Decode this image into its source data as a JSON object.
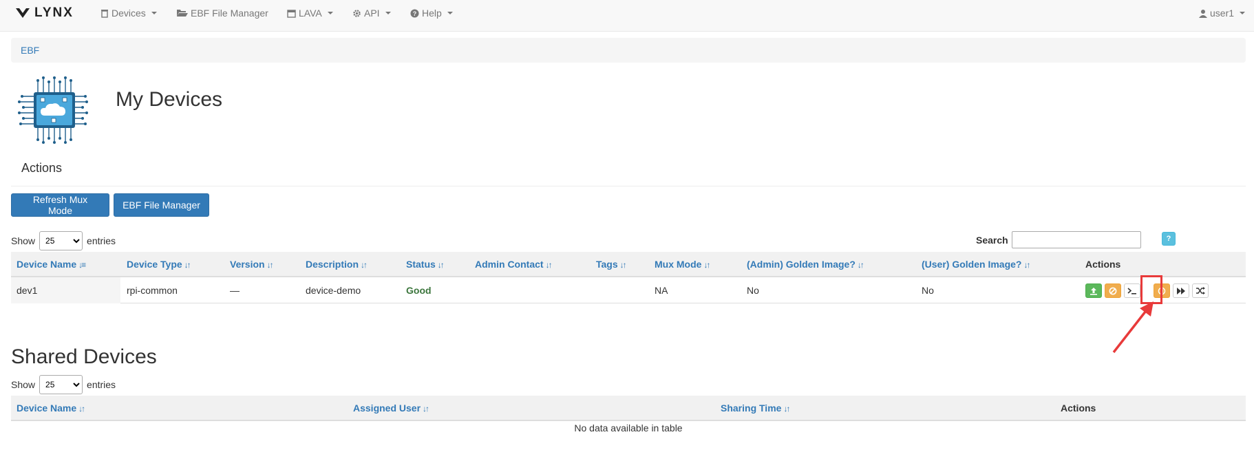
{
  "navbar": {
    "brand": "LYNX",
    "items": [
      {
        "label": "Devices",
        "icon": "trash-icon",
        "dropdown": true
      },
      {
        "label": "EBF File Manager",
        "icon": "folder-open-icon",
        "dropdown": false
      },
      {
        "label": "LAVA",
        "icon": "calendar-icon",
        "dropdown": true
      },
      {
        "label": "API",
        "icon": "gear-icon",
        "dropdown": true
      },
      {
        "label": "Help",
        "icon": "question-circle-icon",
        "dropdown": true
      }
    ],
    "user": "user1"
  },
  "breadcrumb": "EBF",
  "page_title": "My Devices",
  "actions_title": "Actions",
  "buttons": {
    "refresh_mux": "Refresh Mux Mode",
    "ebf_file_manager": "EBF File Manager"
  },
  "my_devices": {
    "show_label": "Show",
    "entries_label": "entries",
    "page_size": "25",
    "search_label": "Search",
    "help_label": "?",
    "columns": [
      "Device Name",
      "Device Type",
      "Version",
      "Description",
      "Status",
      "Admin Contact",
      "Tags",
      "Mux Mode",
      "(Admin) Golden Image?",
      "(User) Golden Image?",
      "Actions"
    ],
    "rows": [
      {
        "device_name": "dev1",
        "device_type": "rpi-common",
        "version": "—",
        "description": "device-demo",
        "status": "Good",
        "admin_contact": "",
        "tags": "",
        "mux_mode": "NA",
        "admin_golden": "No",
        "user_golden": "No",
        "actions": [
          "upload-icon",
          "ban-icon",
          "terminal-icon",
          "cancel-circle-icon",
          "fast-forward-icon",
          "shuffle-icon"
        ]
      }
    ]
  },
  "shared_devices": {
    "title": "Shared Devices",
    "show_label": "Show",
    "entries_label": "entries",
    "page_size": "25",
    "columns": [
      "Device Name",
      "Assigned User",
      "Sharing Time",
      "Actions"
    ],
    "empty_text": "No data available in table"
  },
  "colors": {
    "primary": "#337ab7",
    "success": "#5cb85c",
    "warning": "#f0ad4e",
    "info": "#5bc0de",
    "highlight": "#e83a3a"
  }
}
